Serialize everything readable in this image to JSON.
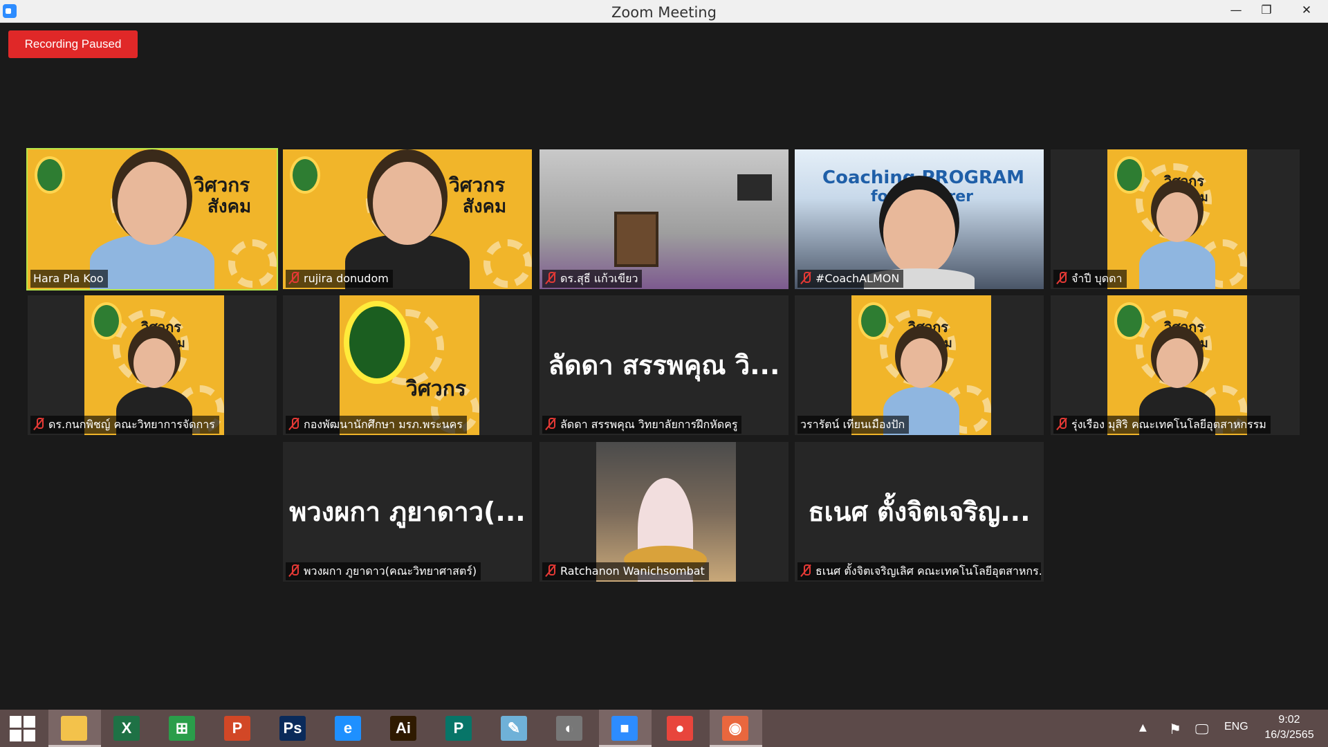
{
  "window": {
    "title": "Zoom Meeting",
    "minimize_glyph": "—",
    "maximize_glyph": "❐",
    "close_glyph": "✕"
  },
  "recording": {
    "label": "Recording Paused",
    "color": "#e02828"
  },
  "active_speaker_color": "#b6e54a",
  "tiles": [
    {
      "name": "Hara Pla Koo",
      "muted": false,
      "active": true,
      "video": "banner-woman"
    },
    {
      "name": "rujira donudom",
      "muted": true,
      "active": false,
      "video": "banner-woman"
    },
    {
      "name": "ดร.สุธี แก้วเขียว",
      "muted": true,
      "active": false,
      "video": "office"
    },
    {
      "name": "#CoachALMON",
      "muted": true,
      "active": false,
      "video": "coaching",
      "banner_text": "Coaching PROGRAM",
      "banner_text2": "for Lecturer"
    },
    {
      "name": "จำปี บุดดา",
      "muted": true,
      "active": false,
      "video": "banner-portrait"
    },
    {
      "name": "ดร.กนกพิชญ์ คณะวิทยาการจัดการ",
      "muted": true,
      "active": false,
      "video": "banner-portrait"
    },
    {
      "name": "กองพัฒนานักศึกษา มรภ.พระนคร",
      "muted": true,
      "active": false,
      "video": "banner-seal"
    },
    {
      "name": "ลัดดา สรรพคุณ วิทยาลัยการฝึกหัดครู",
      "muted": true,
      "active": false,
      "video": "none",
      "big_name": "ลัดดา สรรพคุณ วิ..."
    },
    {
      "name": "วรารัตน์ เทียนเมืองปัก",
      "muted": false,
      "active": false,
      "video": "banner-portrait"
    },
    {
      "name": "รุ่งเรือง มุสิริ คณะเทคโนโลยีอุตสาหกรรม",
      "muted": true,
      "active": false,
      "video": "banner-portrait"
    },
    {
      "name": "พวงผกา ภูยาดาว(คณะวิทยาศาสตร์)",
      "muted": true,
      "active": false,
      "video": "none",
      "big_name": "พวงผกา ภูยาดาว(..."
    },
    {
      "name": "Ratchanon Wanichsombat",
      "muted": true,
      "active": false,
      "video": "restaurant"
    },
    {
      "name": "ธเนศ ตั้งจิตเจริญเลิศ คณะเทคโนโลยีอุตสาหกร...",
      "muted": true,
      "active": false,
      "video": "none",
      "big_name": "ธเนศ ตั้งจิตเจริญ..."
    }
  ],
  "banner": {
    "title_line1": "วิศวกร",
    "title_line2": "สังคม"
  },
  "taskbar": {
    "apps": [
      {
        "name": "file-explorer",
        "glyph": "",
        "color": "#f3c24b",
        "open": true
      },
      {
        "name": "excel",
        "glyph": "X",
        "color": "#1e7145",
        "open": false
      },
      {
        "name": "store",
        "glyph": "⊞",
        "color": "#2a9d4a",
        "open": false
      },
      {
        "name": "powerpoint",
        "glyph": "P",
        "color": "#d24726",
        "open": false
      },
      {
        "name": "photoshop",
        "glyph": "Ps",
        "color": "#0a2a5a",
        "open": false
      },
      {
        "name": "internet-explorer",
        "glyph": "e",
        "color": "#1e90ff",
        "open": false
      },
      {
        "name": "illustrator",
        "glyph": "Ai",
        "color": "#2f1a00",
        "open": false
      },
      {
        "name": "publisher",
        "glyph": "P",
        "color": "#077568",
        "open": false
      },
      {
        "name": "notepad",
        "glyph": "✎",
        "color": "#6fb1d8",
        "open": false
      },
      {
        "name": "hotocape",
        "glyph": "◐",
        "color": "#777777",
        "open": false
      },
      {
        "name": "zoom",
        "glyph": "■",
        "color": "#2d8cff",
        "open": true
      },
      {
        "name": "chrome",
        "glyph": "●",
        "color": "#e8453c",
        "open": false
      },
      {
        "name": "screen-recorder",
        "glyph": "◉",
        "color": "#e9673e",
        "open": true
      }
    ],
    "tray": {
      "chevron": "▲",
      "language": "ENG",
      "time": "9:02",
      "date": "16/3/2565"
    }
  }
}
